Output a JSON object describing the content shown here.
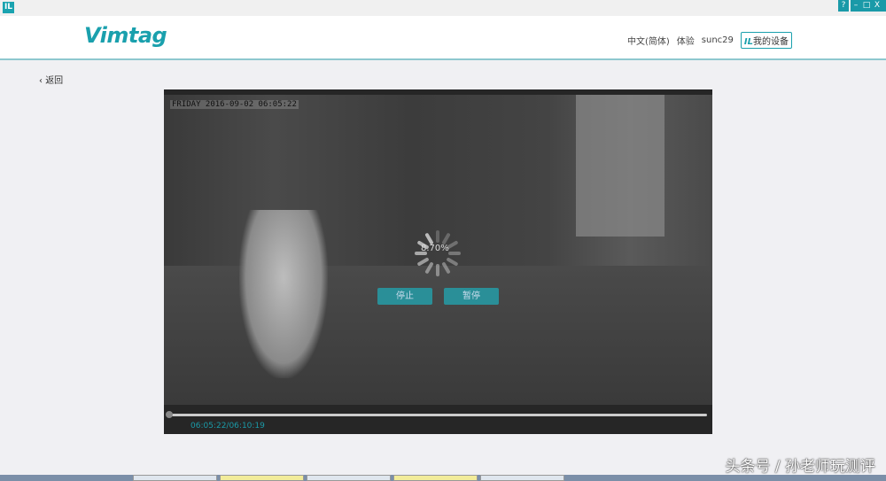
{
  "window": {
    "controls": [
      "?",
      "–",
      "□",
      "X"
    ]
  },
  "header": {
    "logo": "Vimtag",
    "nav": {
      "language": "中文(简体)",
      "experience": "体验",
      "user": "sunc29",
      "my_devices": "我的设备",
      "my_devices_icon": "IL"
    }
  },
  "back": {
    "label": "返回"
  },
  "player": {
    "osd_timestamp": "FRIDAY 2016-09-02 06:05:22",
    "loading_percent": "8.70%",
    "stop_label": "停止",
    "pause_label": "暂停",
    "time": "06:05:22/06:10:19",
    "progress": 0
  },
  "watermark": "头条号 / 孙老师玩测评",
  "colors": {
    "accent": "#1aa0ad"
  }
}
